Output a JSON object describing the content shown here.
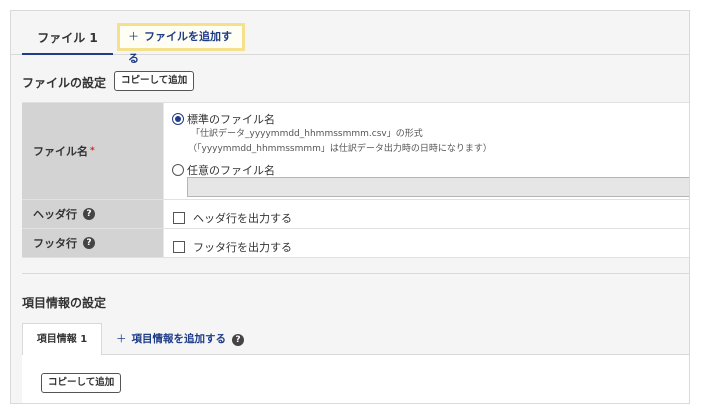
{
  "file_tabs": {
    "active": "ファイル 1",
    "add": "ファイルを追加する",
    "add_symbol": "＋"
  },
  "file_settings": {
    "title": "ファイルの設定",
    "copy_button": "コピーして追加"
  },
  "file_name": {
    "label": "ファイル名",
    "required_mark": "*",
    "standard_option": "標準のファイル名",
    "standard_note_1": "「仕訳データ_yyyymmdd_hhmmssmmm.csv」の形式",
    "standard_note_2": "（「yyyymmdd_hhmmssmmm」は仕訳データ出力時の日時になります）",
    "custom_option": "任意のファイル名",
    "custom_value": ""
  },
  "header_row": {
    "label": "ヘッダ行",
    "option": "ヘッダ行を出力する"
  },
  "footer_row": {
    "label": "フッタ行",
    "option": "フッタ行を出力する"
  },
  "item_settings": {
    "title": "項目情報の設定",
    "tab_active": "項目情報 1",
    "tab_add": "項目情報を追加する",
    "add_symbol": "＋",
    "copy_button": "コピーして追加"
  },
  "help_icon_glyph": "?",
  "colors": {
    "accent": "#1f3c88",
    "highlight_border": "#f5e08e",
    "required": "#cc2b2b"
  }
}
